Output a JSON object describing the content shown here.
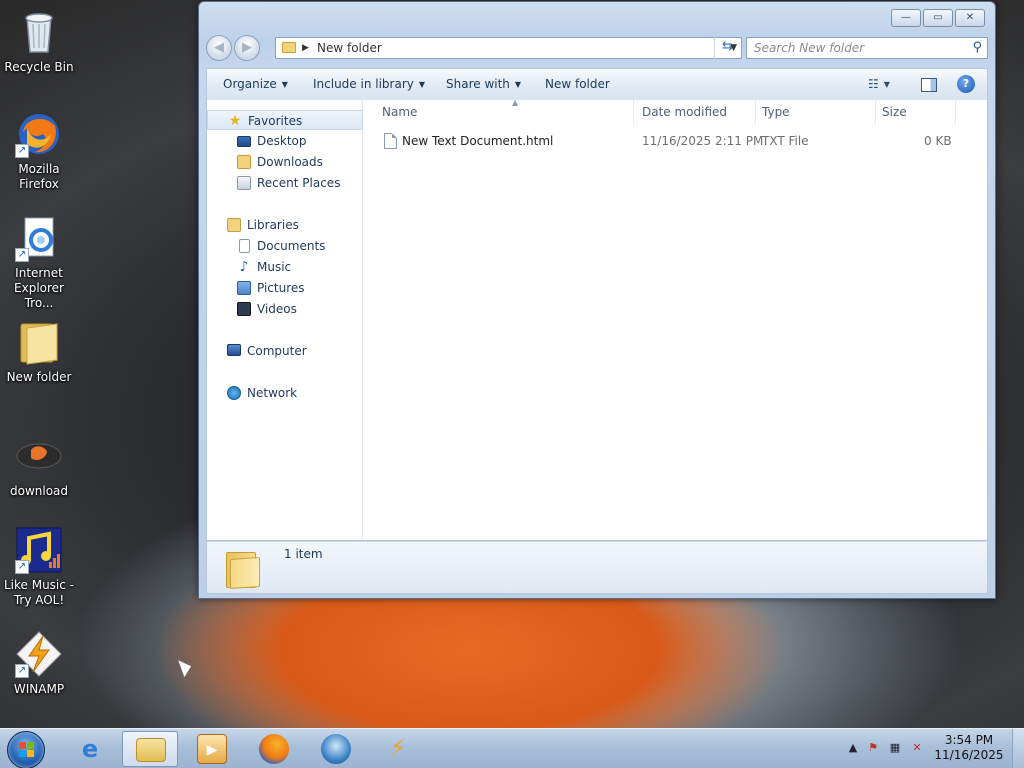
{
  "desktop": {
    "icons": [
      {
        "label": "Recycle Bin",
        "icon": "recycle-bin-icon"
      },
      {
        "label": "Mozilla Firefox",
        "icon": "firefox-icon"
      },
      {
        "label": "Internet Explorer Tro...",
        "icon": "internet-explorer-icon"
      },
      {
        "label": "New folder",
        "icon": "folder-icon"
      },
      {
        "label": "download",
        "icon": "download-icon"
      },
      {
        "label": "Like Music - Try AOL!",
        "icon": "music-icon"
      },
      {
        "label": "WINAMP",
        "icon": "winamp-icon"
      }
    ]
  },
  "window": {
    "address_path": "New folder",
    "search_placeholder": "Search New folder",
    "controls": {
      "minimize": "—",
      "maximize": "▭",
      "close": "✕"
    }
  },
  "toolbar": {
    "organize": "Organize",
    "include_in_library": "Include in library",
    "share_with": "Share with",
    "new_folder": "New folder"
  },
  "nav_pane": {
    "favorites": "Favorites",
    "desktop": "Desktop",
    "downloads": "Downloads",
    "recent_places": "Recent Places",
    "libraries": "Libraries",
    "documents": "Documents",
    "music": "Music",
    "pictures": "Pictures",
    "videos": "Videos",
    "computer": "Computer",
    "network": "Network"
  },
  "columns": {
    "name": "Name",
    "date_modified": "Date modified",
    "type": "Type",
    "size": "Size"
  },
  "files": [
    {
      "name": "New Text Document.html",
      "date_modified": "11/16/2025 2:11 PM",
      "type": "TXT File",
      "size": "0 KB"
    }
  ],
  "details": {
    "item_count": "1 item"
  },
  "taskbar": {
    "pinned": [
      "internet-explorer-icon",
      "windows-explorer-icon",
      "media-player-icon",
      "firefox-icon",
      "globe-icon",
      "winamp-icon"
    ],
    "clock_time": "3:54 PM",
    "clock_date": "11/16/2025"
  },
  "colors": {
    "window_frame": "#c5d7ee",
    "selection": "#dce8f6",
    "accent": "#1e395b"
  }
}
